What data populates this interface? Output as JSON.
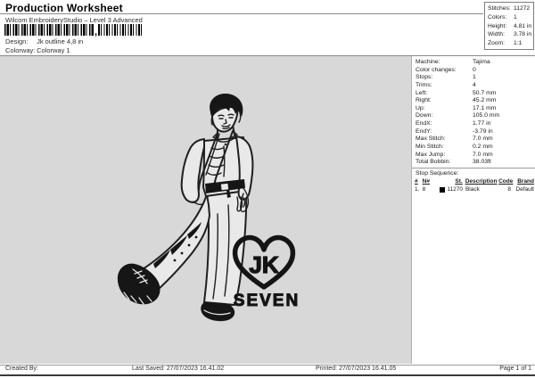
{
  "page": {
    "title": "Production Worksheet",
    "subtitle": "Wilcom EmbroideryStudio – Level 3 Advanced"
  },
  "design_info": {
    "design_label": "Design:",
    "design_value": "Jk outline 4,8 in",
    "colorway_label": "Colorway:",
    "colorway_value": "Colorway 1",
    "barcode_separator": ","
  },
  "summary": {
    "rows": [
      {
        "label": "Stitches:",
        "value": "11272"
      },
      {
        "label": "Colors:",
        "value": "1"
      },
      {
        "label": "Height:",
        "value": "4.81 in"
      },
      {
        "label": "Width:",
        "value": "3.78 in"
      },
      {
        "label": "Zoom:",
        "value": "1:1"
      }
    ]
  },
  "machine": {
    "rows": [
      {
        "label": "Machine:",
        "value": "Tajima"
      },
      {
        "label": "Color changes:",
        "value": "0"
      },
      {
        "label": "Stops:",
        "value": "1"
      },
      {
        "label": "Trims:",
        "value": "4"
      },
      {
        "label": "Left:",
        "value": "50.7 mm"
      },
      {
        "label": "Right:",
        "value": "45.2 mm"
      },
      {
        "label": "Up:",
        "value": "17.1 mm"
      },
      {
        "label": "Down:",
        "value": "105.0 mm"
      },
      {
        "label": "EndX:",
        "value": "1.77 in"
      },
      {
        "label": "EndY:",
        "value": "-3.79 in"
      },
      {
        "label": "Max Stitch:",
        "value": "7.0 mm"
      },
      {
        "label": "Min Stitch:",
        "value": "0.2 mm"
      },
      {
        "label": "Max Jump:",
        "value": "7.0 mm"
      },
      {
        "label": "Total Bobbin:",
        "value": "38.03ft"
      }
    ]
  },
  "stop_sequence": {
    "title": "Stop Sequence:",
    "headers": {
      "num": "#",
      "needle": "N#",
      "stitches": "St.",
      "description": "Description",
      "code": "Code",
      "brand": "Brand"
    },
    "rows": [
      {
        "num": "1.",
        "needle": "8",
        "stitches": "11270",
        "description": "Black",
        "code": "8",
        "brand": "Default",
        "swatch_color": "#000000"
      }
    ]
  },
  "artwork": {
    "logo_initials": "JK",
    "logo_word": "SEVEN"
  },
  "footer": {
    "created_by": "Created By:",
    "last_saved": "Last Saved: 27/07/2023 16.41.02",
    "printed": "Printed: 27/07/2023 16.41.05",
    "page_number": "Page 1 of 1"
  },
  "colors": {
    "design_area_bg": "#d8d8d8",
    "stitch_line": "#1f1f1f",
    "swatch_black": "#000000"
  }
}
